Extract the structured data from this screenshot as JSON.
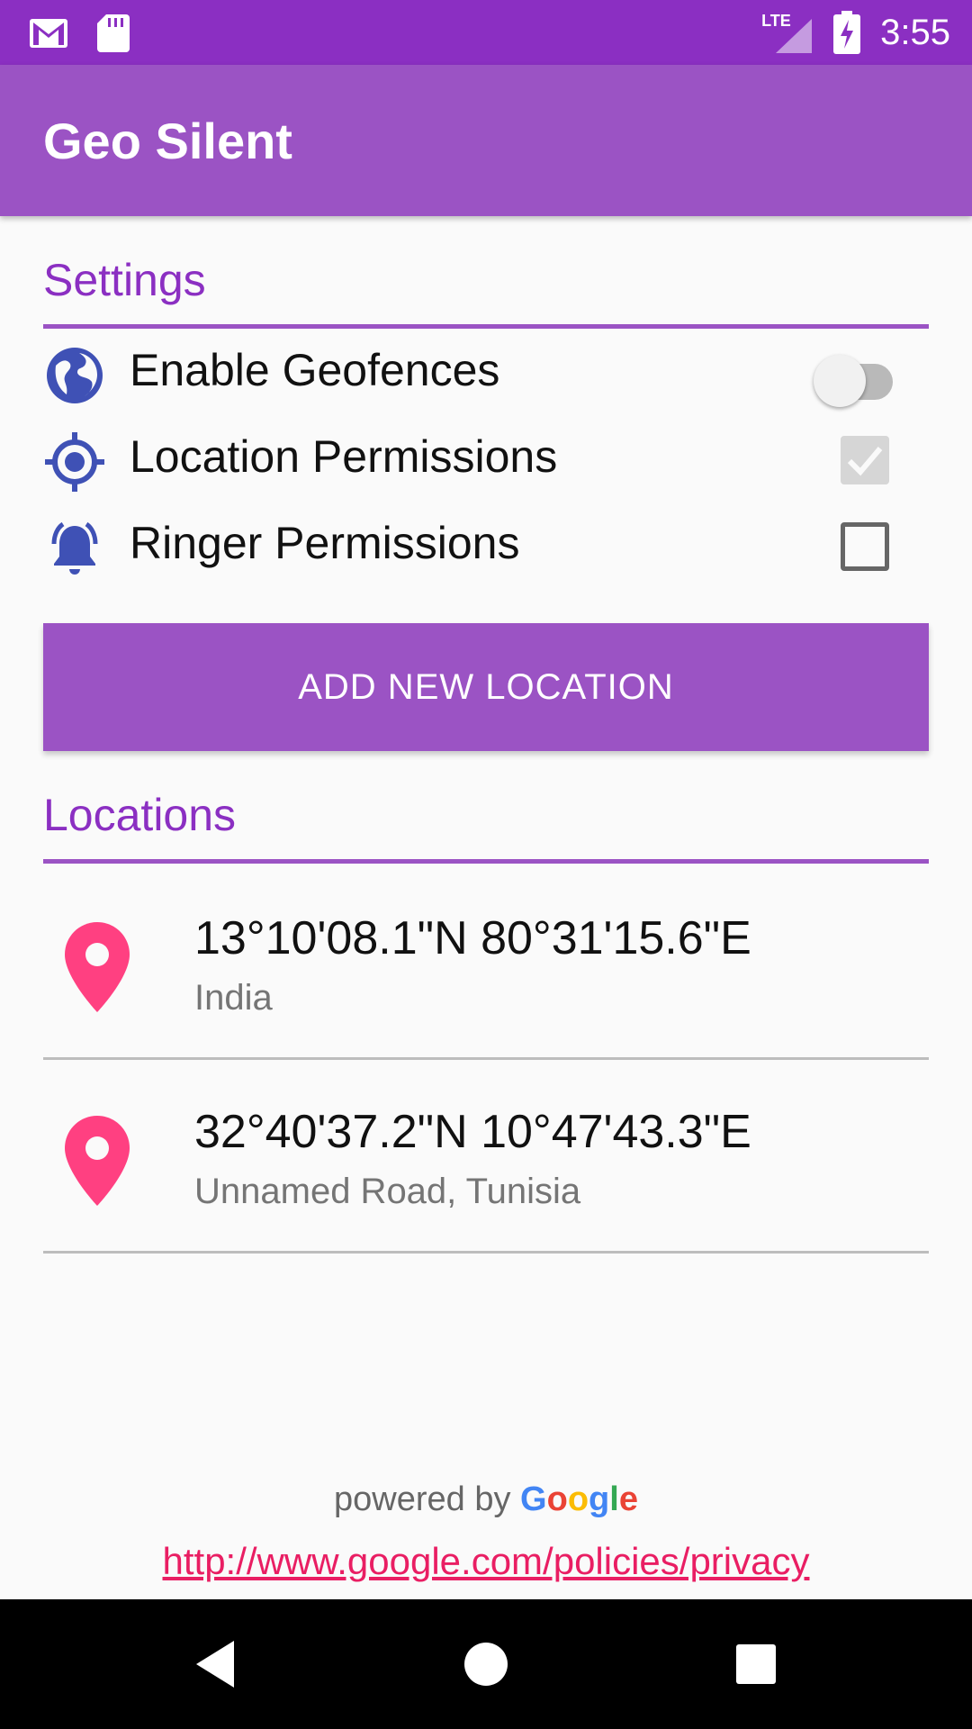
{
  "status_bar": {
    "time": "3:55",
    "network": "LTE",
    "icons": [
      "gmail-icon",
      "sd-card-icon",
      "signal-icon",
      "battery-charging-icon"
    ]
  },
  "app_bar": {
    "title": "Geo Silent"
  },
  "settings": {
    "title": "Settings",
    "items": [
      {
        "label": "Enable Geofences",
        "icon": "globe-icon",
        "control": "switch",
        "state": false
      },
      {
        "label": "Location Permissions",
        "icon": "gps-target-icon",
        "control": "checkbox",
        "state": true
      },
      {
        "label": "Ringer Permissions",
        "icon": "bell-ringing-icon",
        "control": "checkbox",
        "state": false
      }
    ]
  },
  "add_button": {
    "label": "ADD NEW LOCATION"
  },
  "locations": {
    "title": "Locations",
    "items": [
      {
        "coords": "13°10'08.1\"N 80°31'15.6\"E",
        "place": "India"
      },
      {
        "coords": "32°40'37.2\"N 10°47'43.3\"E",
        "place": "Unnamed Road, Tunisia"
      }
    ]
  },
  "footer": {
    "powered_by": "powered by",
    "google": "Google",
    "privacy_url": "http://www.google.com/policies/privacy"
  },
  "colors": {
    "status_bar": "#8b2fc2",
    "primary": "#9b53c4",
    "accent_pin": "#ff4081",
    "icon_blue": "#3f51b5",
    "link": "#e91e63"
  }
}
